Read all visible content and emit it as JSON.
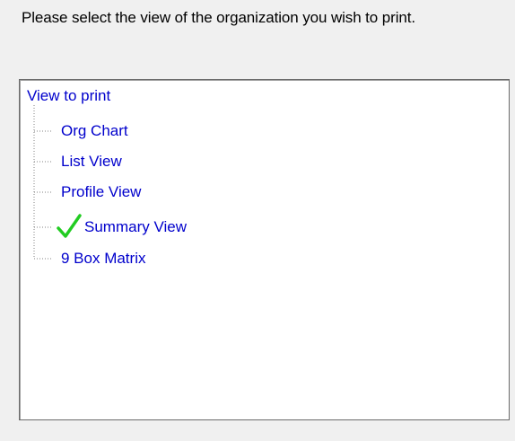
{
  "prompt": "Please select the view of the organization you wish to print.",
  "tree": {
    "root_label": "View to print",
    "items": [
      {
        "label": "Org Chart",
        "checked": false
      },
      {
        "label": "List View",
        "checked": false
      },
      {
        "label": "Profile View",
        "checked": false
      },
      {
        "label": "Summary View",
        "checked": true
      },
      {
        "label": "9 Box Matrix",
        "checked": false
      }
    ]
  },
  "colors": {
    "item_text": "#0000cc",
    "check": "#22cc22",
    "connector": "#808080"
  },
  "icons": {
    "check": "check-icon"
  }
}
